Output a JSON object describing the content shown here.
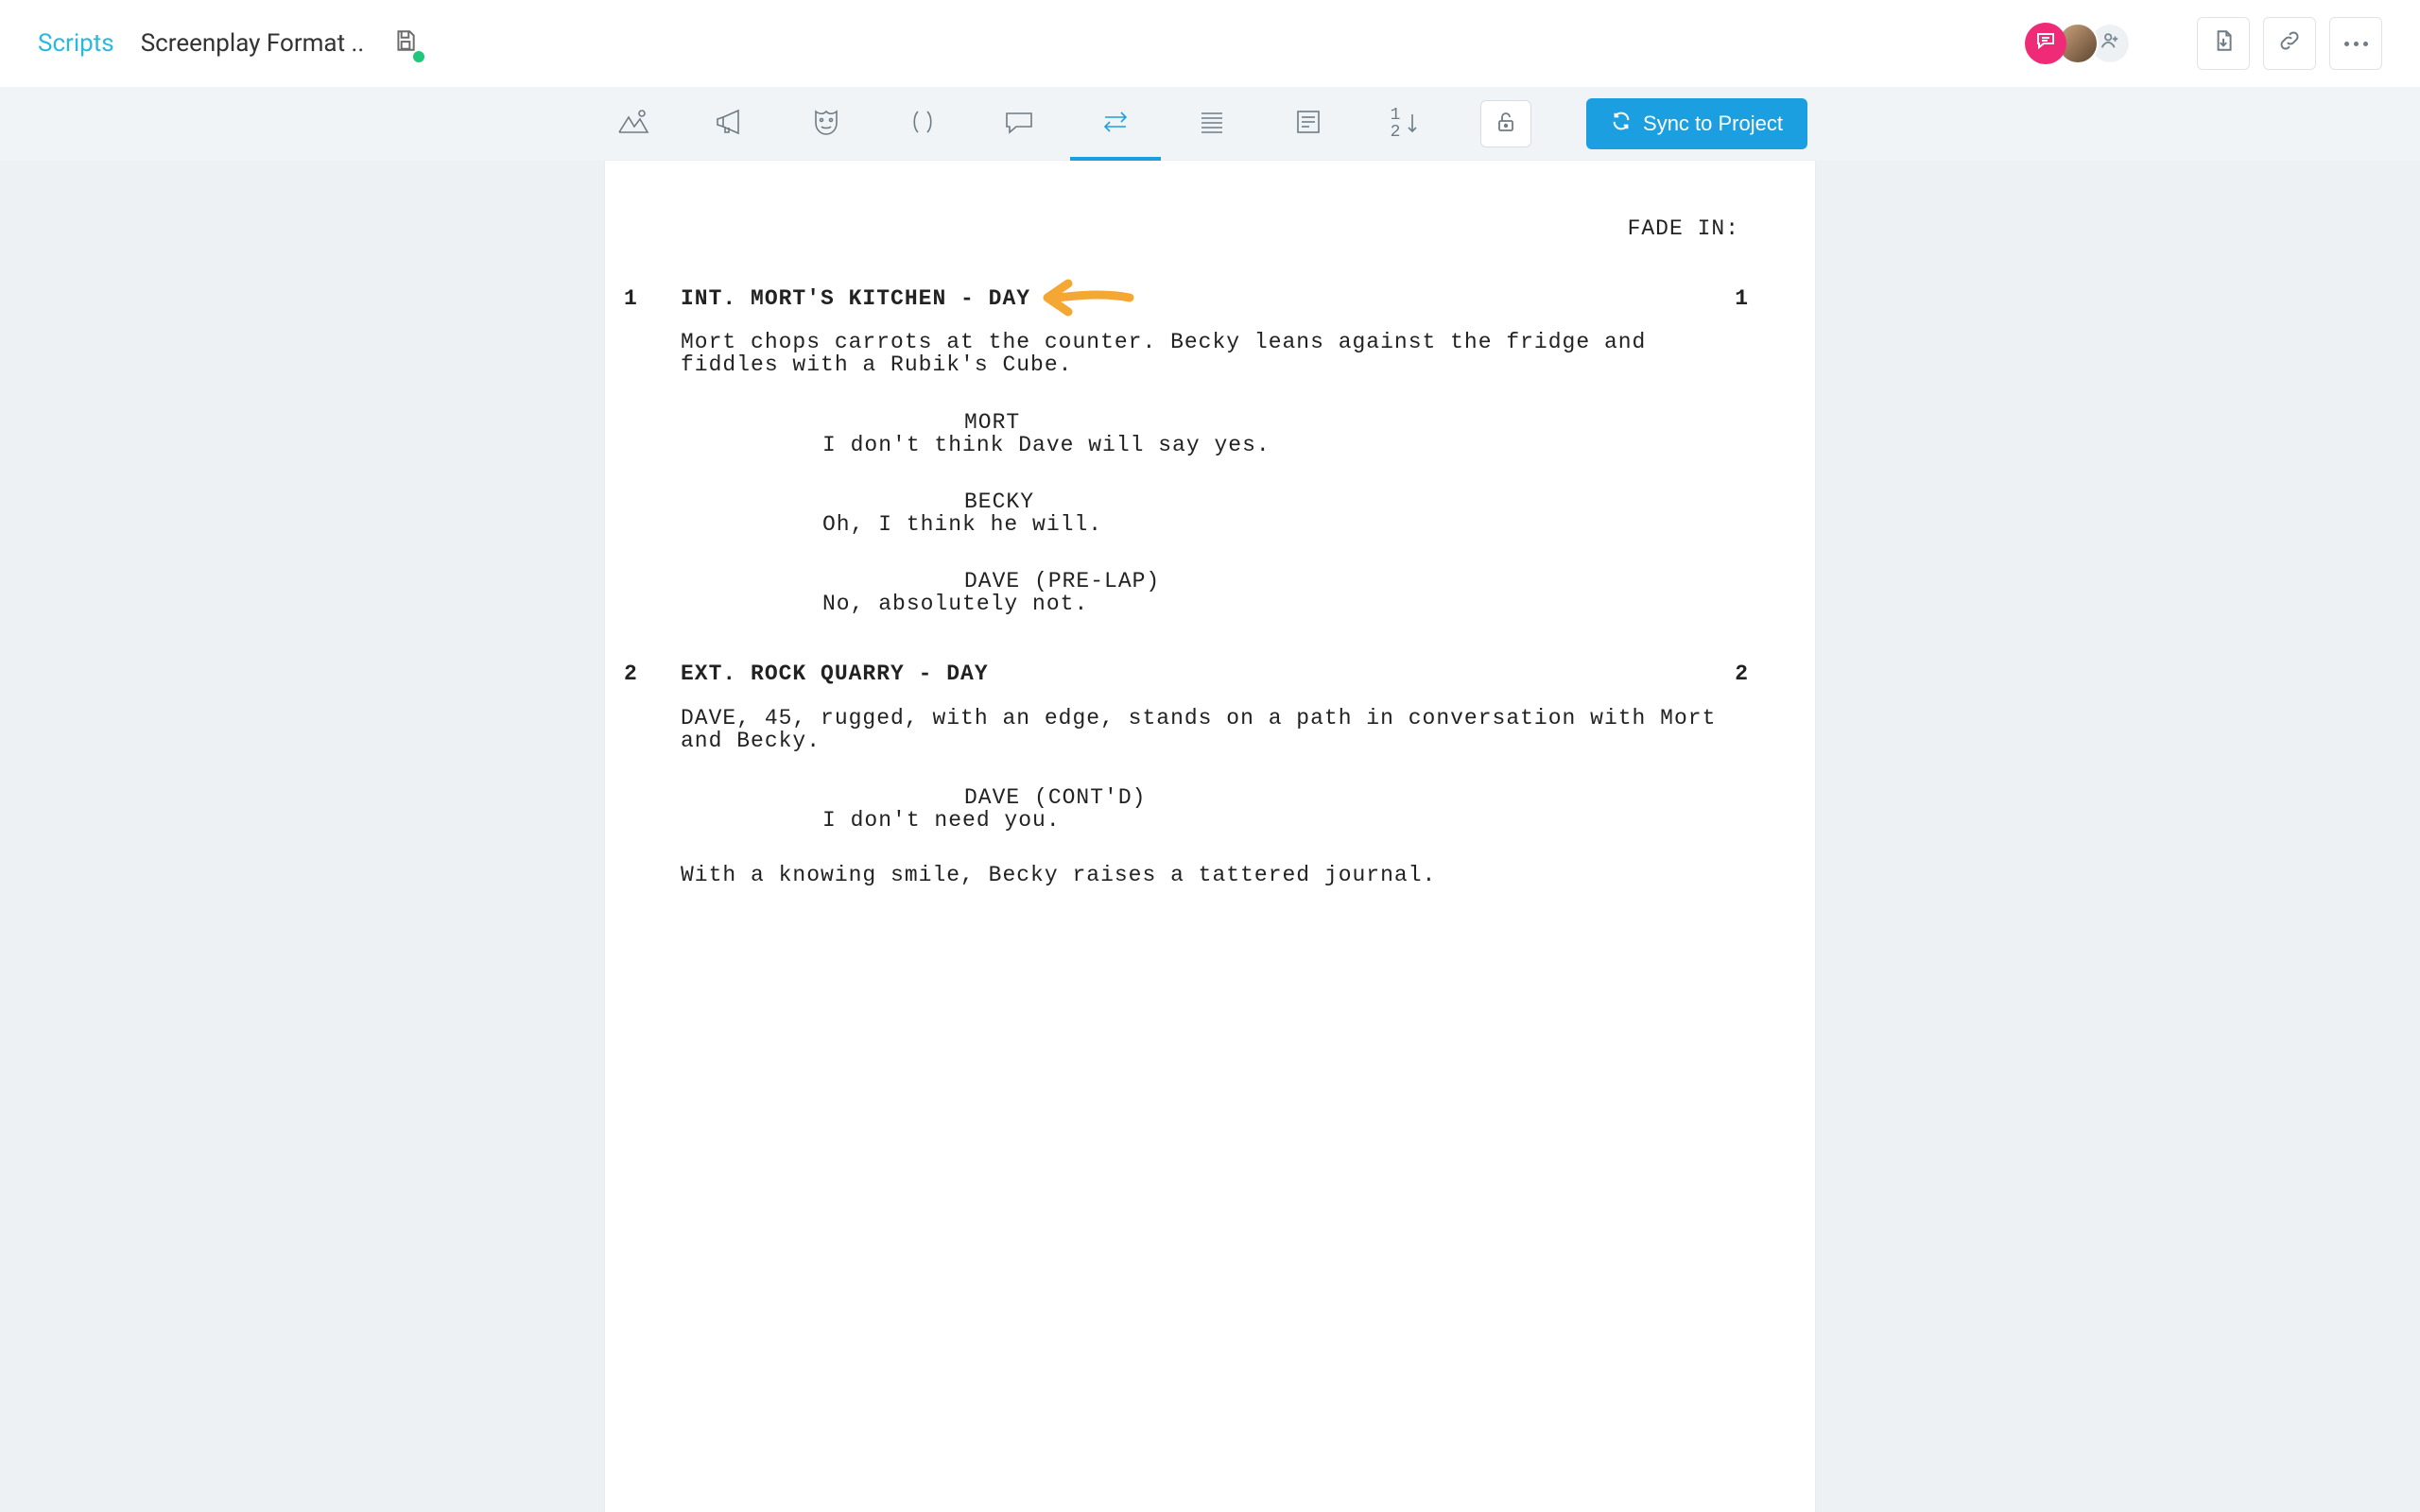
{
  "header": {
    "breadcrumb_root": "Scripts",
    "breadcrumb_current": "Screenplay Format .."
  },
  "toolbar": {
    "sync_label": "Sync to Project"
  },
  "script": {
    "fade_in": "FADE IN:",
    "scenes": [
      {
        "num": "1",
        "heading": "INT. MORT'S KITCHEN - DAY",
        "action1": "Mort chops carrots at the counter. Becky leans against the fridge and fiddles with a Rubik's Cube.",
        "d1_char": "MORT",
        "d1_line": "I don't think Dave will say yes.",
        "d2_char": "BECKY",
        "d2_line": "Oh, I think he will.",
        "d3_char": "DAVE (PRE-LAP)",
        "d3_line": "No, absolutely not."
      },
      {
        "num": "2",
        "heading": "EXT. ROCK QUARRY - DAY",
        "action1": "DAVE, 45, rugged, with an edge, stands on a path in conversation with Mort and Becky.",
        "d1_char": "DAVE (CONT'D)",
        "d1_line": "I don't need you.",
        "action2": "With a knowing smile, Becky raises a tattered journal."
      }
    ]
  }
}
